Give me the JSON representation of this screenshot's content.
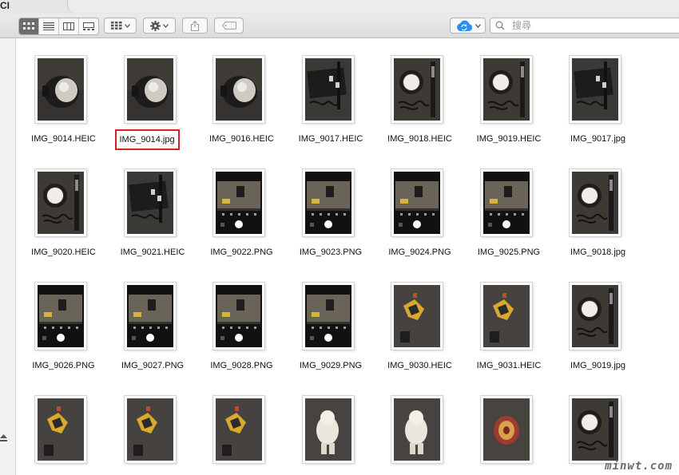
{
  "window": {
    "title": "CI"
  },
  "toolbar": {
    "view_buttons": [
      "icon-view",
      "list-view",
      "column-view",
      "gallery-view"
    ],
    "arrange_icon": "grid-arrange-icon",
    "action_icon": "gear-icon",
    "share_icon": "share-icon",
    "tag_icon": "tag-icon",
    "cloud_icon": "icloud-icon"
  },
  "search": {
    "placeholder": "搜尋"
  },
  "files": [
    {
      "name": "IMG_9014.HEIC",
      "thumb": "lamp"
    },
    {
      "name": "IMG_9014.jpg",
      "thumb": "lamp",
      "highlighted": true
    },
    {
      "name": "IMG_9016.HEIC",
      "thumb": "lamp"
    },
    {
      "name": "IMG_9017.HEIC",
      "thumb": "box"
    },
    {
      "name": "IMG_9018.HEIC",
      "thumb": "bulb"
    },
    {
      "name": "IMG_9019.HEIC",
      "thumb": "bulb"
    },
    {
      "name": "IMG_9017.jpg",
      "thumb": "box"
    },
    {
      "name": "IMG_9020.HEIC",
      "thumb": "bulb"
    },
    {
      "name": "IMG_9021.HEIC",
      "thumb": "box"
    },
    {
      "name": "IMG_9022.PNG",
      "thumb": "screen"
    },
    {
      "name": "IMG_9023.PNG",
      "thumb": "screen"
    },
    {
      "name": "IMG_9024.PNG",
      "thumb": "screen"
    },
    {
      "name": "IMG_9025.PNG",
      "thumb": "screen"
    },
    {
      "name": "IMG_9018.jpg",
      "thumb": "bulb"
    },
    {
      "name": "IMG_9026.PNG",
      "thumb": "screen"
    },
    {
      "name": "IMG_9027.PNG",
      "thumb": "screen"
    },
    {
      "name": "IMG_9028.PNG",
      "thumb": "screen"
    },
    {
      "name": "IMG_9029.PNG",
      "thumb": "screen"
    },
    {
      "name": "IMG_9030.HEIC",
      "thumb": "toy"
    },
    {
      "name": "IMG_9031.HEIC",
      "thumb": "toy"
    },
    {
      "name": "IMG_9019.jpg",
      "thumb": "bulb"
    },
    {
      "name": "",
      "thumb": "toy"
    },
    {
      "name": "",
      "thumb": "toy"
    },
    {
      "name": "",
      "thumb": "toy"
    },
    {
      "name": "",
      "thumb": "figure"
    },
    {
      "name": "",
      "thumb": "figure"
    },
    {
      "name": "",
      "thumb": "can"
    },
    {
      "name": "",
      "thumb": "bulb"
    }
  ],
  "watermark": "minwt.com"
}
